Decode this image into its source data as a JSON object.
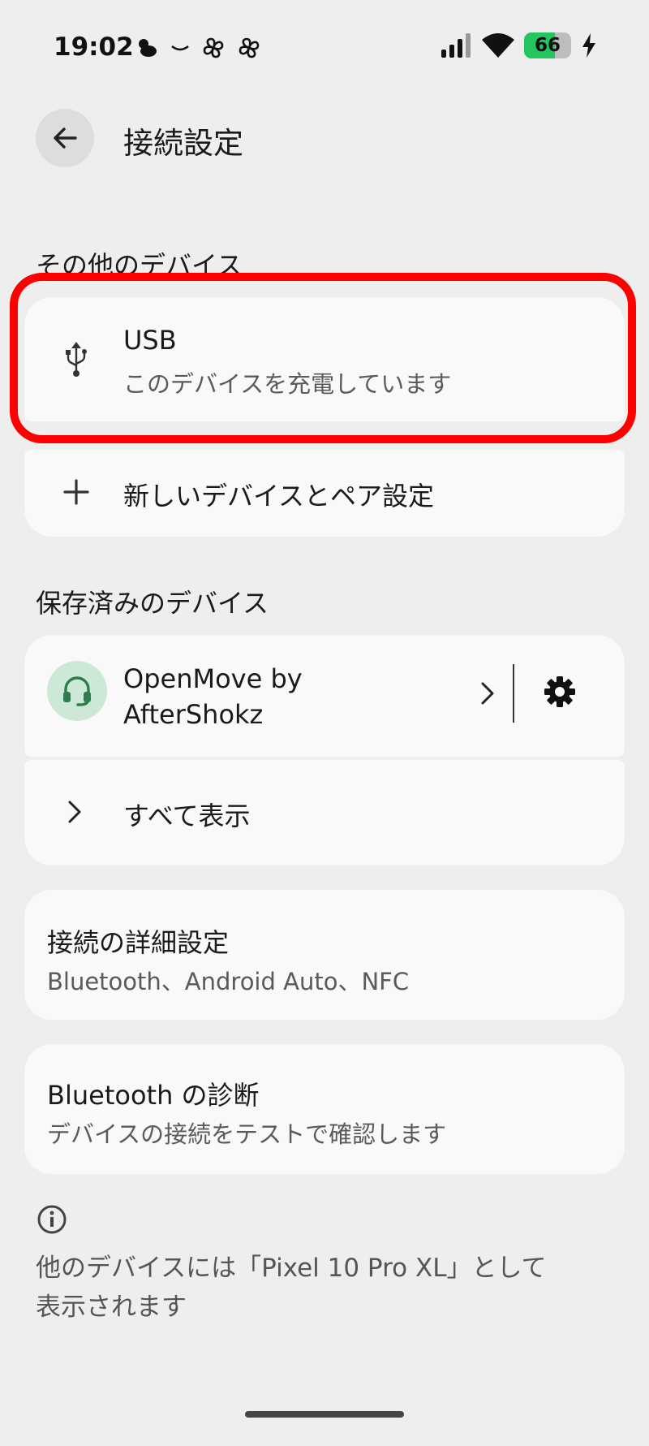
{
  "status_bar": {
    "time": "19:02",
    "battery_level": "66",
    "battery_fraction": 0.66,
    "icons": [
      "weather-icon",
      "minus-icon",
      "fan-icon",
      "fan-icon",
      "signal-icon",
      "wifi-icon",
      "battery-icon",
      "charging-bolt-icon"
    ]
  },
  "header": {
    "title": "接続設定",
    "back_icon": "arrow-left-icon"
  },
  "other_devices": {
    "heading": "その他のデバイス",
    "usb": {
      "title": "USB",
      "subtitle": "このデバイスを充電しています",
      "icon": "usb-icon"
    },
    "pair_new": {
      "label": "新しいデバイスとペア設定",
      "icon": "plus-icon"
    }
  },
  "saved_devices": {
    "heading": "保存済みのデバイス",
    "device": {
      "name": "OpenMove by AfterShokz",
      "name_line1": "OpenMove by",
      "name_line2": "AfterShokz",
      "icon": "headset-icon"
    },
    "show_all": "すべて表示"
  },
  "advanced": {
    "title": "接続の詳細設定",
    "subtitle": "Bluetooth、Android Auto、NFC"
  },
  "diagnostics": {
    "title": "Bluetooth の診断",
    "subtitle": "デバイスの接続をテストで確認します"
  },
  "footer": {
    "info_icon": "info-icon",
    "line1": "他のデバイスには「Pixel 10 Pro XL」として",
    "line2": "表示されます"
  },
  "colors": {
    "background": "#eeeeee",
    "card": "#f9f9f9",
    "highlight": "#ff0000",
    "battery_green": "#22c55e",
    "avatar_bg": "#cde8d6",
    "avatar_icon": "#2e7d4f"
  }
}
